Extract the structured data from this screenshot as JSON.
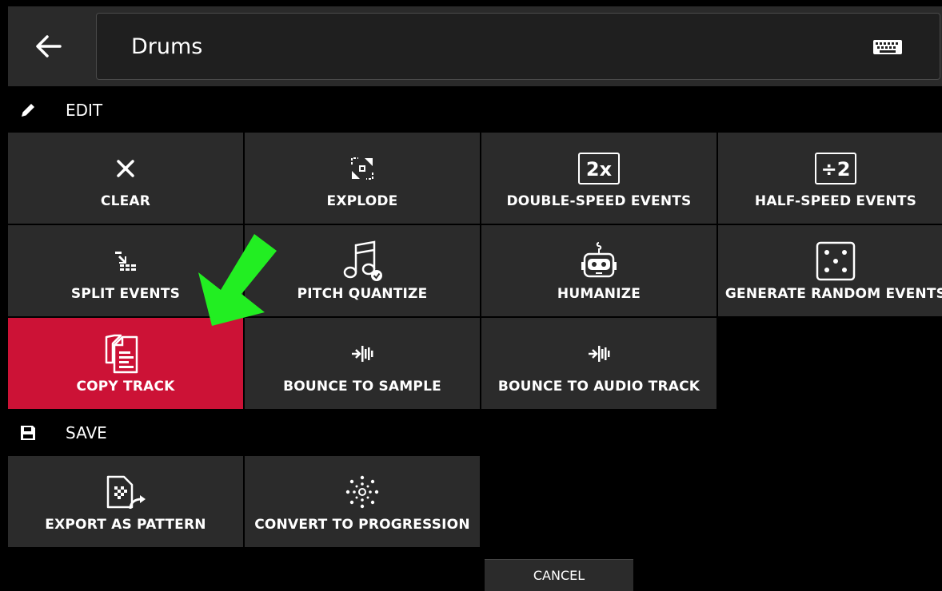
{
  "header": {
    "title": "Drums"
  },
  "sections": {
    "edit_label": "EDIT",
    "save_label": "SAVE"
  },
  "edit_actions": [
    {
      "label": "CLEAR",
      "icon": "close-icon"
    },
    {
      "label": "EXPLODE",
      "icon": "explode-icon"
    },
    {
      "label": "DOUBLE-SPEED EVENTS",
      "icon": "double-speed-icon",
      "icon_text": "2x"
    },
    {
      "label": "HALF-SPEED EVENTS",
      "icon": "half-speed-icon",
      "icon_text": "÷2"
    },
    {
      "label": "SPLIT EVENTS",
      "icon": "split-events-icon"
    },
    {
      "label": "PITCH QUANTIZE",
      "icon": "pitch-quantize-icon"
    },
    {
      "label": "HUMANIZE",
      "icon": "robot-icon"
    },
    {
      "label": "GENERATE RANDOM EVENTS",
      "icon": "dice-icon"
    },
    {
      "label": "COPY TRACK",
      "icon": "copy-track-icon",
      "active": true
    },
    {
      "label": "BOUNCE TO SAMPLE",
      "icon": "bounce-icon"
    },
    {
      "label": "BOUNCE TO AUDIO TRACK",
      "icon": "bounce-icon"
    }
  ],
  "save_actions": [
    {
      "label": "EXPORT AS PATTERN",
      "icon": "export-pattern-icon"
    },
    {
      "label": "CONVERT TO PROGRESSION",
      "icon": "progression-icon"
    }
  ],
  "footer": {
    "cancel_label": "CANCEL"
  },
  "colors": {
    "active_tile": "#cc1236",
    "tile": "#2b2b2b",
    "annotation_arrow": "#22ee22"
  }
}
